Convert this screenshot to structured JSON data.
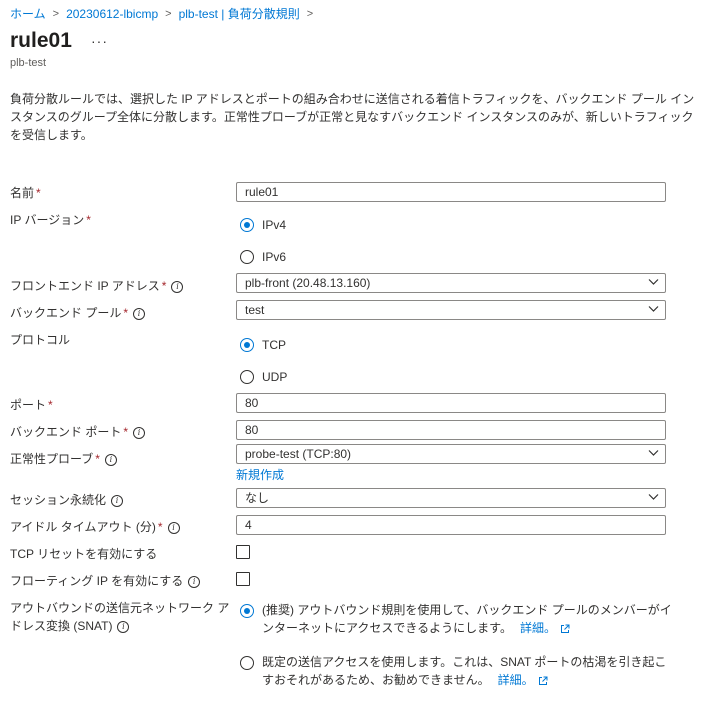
{
  "breadcrumb": [
    {
      "label": "ホーム"
    },
    {
      "label": "20230612-lbicmp"
    },
    {
      "label": "plb-test | 負荷分散規則"
    }
  ],
  "header": {
    "title": "rule01",
    "subtitle": "plb-test",
    "more": "···"
  },
  "description": "負荷分散ルールでは、選択した IP アドレスとポートの組み合わせに送信される着信トラフィックを、バックエンド プール インスタンスのグループ全体に分散します。正常性プローブが正常と見なすバックエンド インスタンスのみが、新しいトラフィックを受信します。",
  "form": {
    "name": {
      "label": "名前",
      "value": "rule01"
    },
    "ip_version": {
      "label": "IP バージョン",
      "options": [
        "IPv4",
        "IPv6"
      ],
      "selected": "IPv4"
    },
    "frontend_ip": {
      "label": "フロントエンド IP アドレス",
      "value": "plb-front (20.48.13.160)"
    },
    "backend_pool": {
      "label": "バックエンド プール",
      "value": "test"
    },
    "protocol": {
      "label": "プロトコル",
      "options": [
        "TCP",
        "UDP"
      ],
      "selected": "TCP"
    },
    "port": {
      "label": "ポート",
      "value": "80"
    },
    "backend_port": {
      "label": "バックエンド ポート",
      "value": "80"
    },
    "health_probe": {
      "label": "正常性プローブ",
      "value": "probe-test (TCP:80)",
      "create_new": "新規作成"
    },
    "session_persistence": {
      "label": "セッション永続化",
      "value": "なし"
    },
    "idle_timeout": {
      "label": "アイドル タイムアウト (分)",
      "value": "4"
    },
    "tcp_reset": {
      "label": "TCP リセットを有効にする",
      "checked": false
    },
    "floating_ip": {
      "label": "フローティング IP を有効にする",
      "checked": false
    },
    "snat": {
      "label_line1": "アウトバウンドの送信元ネットワーク ア",
      "label_line2": "ドレス変換 (SNAT)",
      "option1_line1": "(推奨) アウトバウンド規則を使用して、バックエンド プールのメンバーがイ",
      "option1_line2": "ンターネットにアクセスできるようにします。",
      "option1_link": "詳細。",
      "option2_line1": "既定の送信アクセスを使用します。これは、SNAT ポートの枯渇を引き起こ",
      "option2_line2": "すおそれがあるため、お勧めできません。",
      "option2_link": "詳細。",
      "selected": 1
    }
  },
  "colors": {
    "accent": "#0078d4",
    "required": "#a4262c",
    "border": "#8a8886"
  }
}
